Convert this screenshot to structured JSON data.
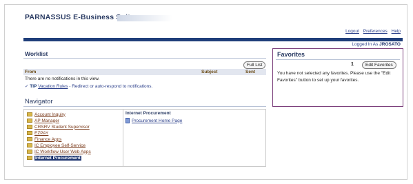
{
  "header": {
    "brand": "PARNASSUS E-Business Suite",
    "links": [
      "Logout",
      "Preferences",
      "Help"
    ],
    "logged_in_prefix": "Logged In As",
    "logged_in_user": "JROSATO"
  },
  "worklist": {
    "title": "Worklist",
    "full_list_label": "Full List",
    "columns": [
      "From",
      "Subject",
      "Sent"
    ],
    "empty_message": "There are no notifications in this view.",
    "tip_label": "TIP",
    "tip_link": "Vacation Rules",
    "tip_text": "- Redirect or auto-respond to notifications."
  },
  "navigator": {
    "title": "Navigator",
    "items": [
      {
        "label": "Account Inquiry",
        "selected": false
      },
      {
        "label": "AP Manager",
        "selected": false
      },
      {
        "label": "CRSRV Student Supervisor",
        "selected": false
      },
      {
        "label": "EZPAY",
        "selected": false
      },
      {
        "label": "Finance Apps",
        "selected": false
      },
      {
        "label": "IC Employee Self-Service",
        "selected": false
      },
      {
        "label": "IC Workflow User Web Apps",
        "selected": false
      },
      {
        "label": "Internet Procurement",
        "selected": true
      }
    ],
    "selected_section": {
      "title": "Internet Procurement",
      "items": [
        "Procurement Home Page"
      ]
    }
  },
  "favorites": {
    "title": "Favorites",
    "count": "1",
    "edit_label": "Edit Favorites",
    "message": "You have not selected any favorites. Please use the \"Edit Favorites\" button to set up your favorites."
  },
  "colors": {
    "accent": "#1f3e7a",
    "link": "#2b3f8a",
    "favorites_border": "#7b3f7b"
  }
}
